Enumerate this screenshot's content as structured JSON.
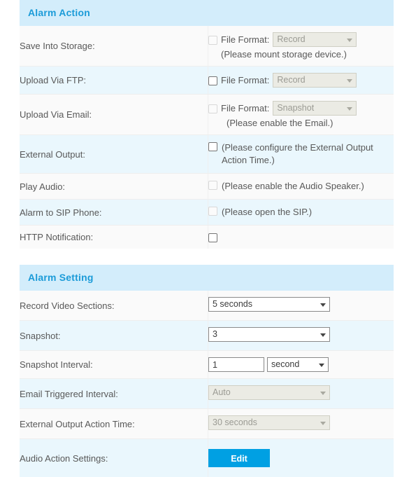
{
  "sections": [
    {
      "title": "Alarm Action",
      "rows": [
        {
          "label": "Save Into Storage:",
          "checkbox_enabled": false,
          "field_label": "File Format:",
          "select_value": "Record",
          "select_enabled": false,
          "note": "(Please mount storage device.)"
        },
        {
          "label": "Upload Via FTP:",
          "checkbox_enabled": true,
          "field_label": "File Format:",
          "select_value": "Record",
          "select_enabled": false,
          "note": ""
        },
        {
          "label": "Upload Via Email:",
          "checkbox_enabled": false,
          "field_label": "File Format:",
          "select_value": "Snapshot",
          "select_enabled": false,
          "note": "(Please enable the Email.)"
        },
        {
          "label": "External Output:",
          "checkbox_enabled": true,
          "hint": "(Please configure the External Output Action Time.)"
        },
        {
          "label": "Play Audio:",
          "checkbox_enabled": false,
          "hint": "(Please enable the Audio Speaker.)"
        },
        {
          "label": "Alarm to SIP Phone:",
          "checkbox_enabled": false,
          "hint": "(Please open the SIP.)"
        },
        {
          "label": "HTTP Notification:",
          "checkbox_enabled": true,
          "hint": ""
        }
      ]
    },
    {
      "title": "Alarm Setting",
      "rows": [
        {
          "label": "Record Video Sections:",
          "select_value": "5 seconds",
          "select_enabled": true
        },
        {
          "label": "Snapshot:",
          "select_value": "3",
          "select_enabled": true
        },
        {
          "label": "Snapshot Interval:",
          "input_value": "1",
          "unit_value": "second",
          "unit_enabled": true
        },
        {
          "label": "Email Triggered Interval:",
          "select_value": "Auto",
          "select_enabled": false
        },
        {
          "label": "External Output Action Time:",
          "select_value": "30 seconds",
          "select_enabled": false
        },
        {
          "label": "Audio Action Settings:",
          "button_label": "Edit"
        }
      ]
    }
  ],
  "colors": {
    "header_bg": "#d3edfb",
    "header_text": "#1b9bd8",
    "row_blue": "#eaf7fd",
    "row_gray": "#fafafa",
    "button_blue": "#00a0e3"
  }
}
